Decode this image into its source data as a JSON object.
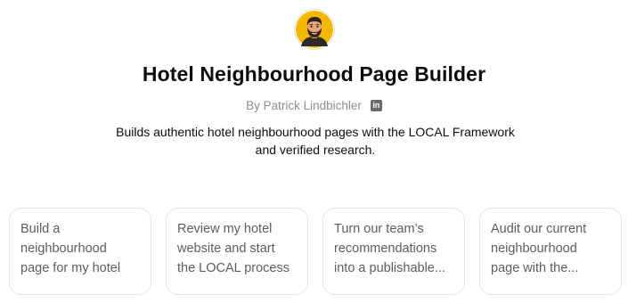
{
  "header": {
    "avatar_icon": "avatar-bearded-man-icon",
    "title": "Hotel Neighbourhood Page Builder",
    "byline": "By Patrick Lindbichler",
    "social_icon": "linkedin-icon",
    "description_line1": "Builds authentic hotel neighbourhood pages with the LOCAL Framework",
    "description_line2": "and verified research."
  },
  "starters": [
    {
      "line1": "Build a",
      "line2": "neighbourhood",
      "line3": "page for my hotel"
    },
    {
      "line1": "Review my hotel",
      "line2": "website and start",
      "line3": "the LOCAL process"
    },
    {
      "line1": "Turn our team’s",
      "line2": "recommendations",
      "line3": "into a publishable..."
    },
    {
      "line1": "Audit our current",
      "line2": "neighbourhood",
      "line3": "page with the..."
    }
  ],
  "colors": {
    "avatar_background": "#f5b800",
    "card_border": "#e5e5e5",
    "muted_text": "#8e8e8e"
  }
}
